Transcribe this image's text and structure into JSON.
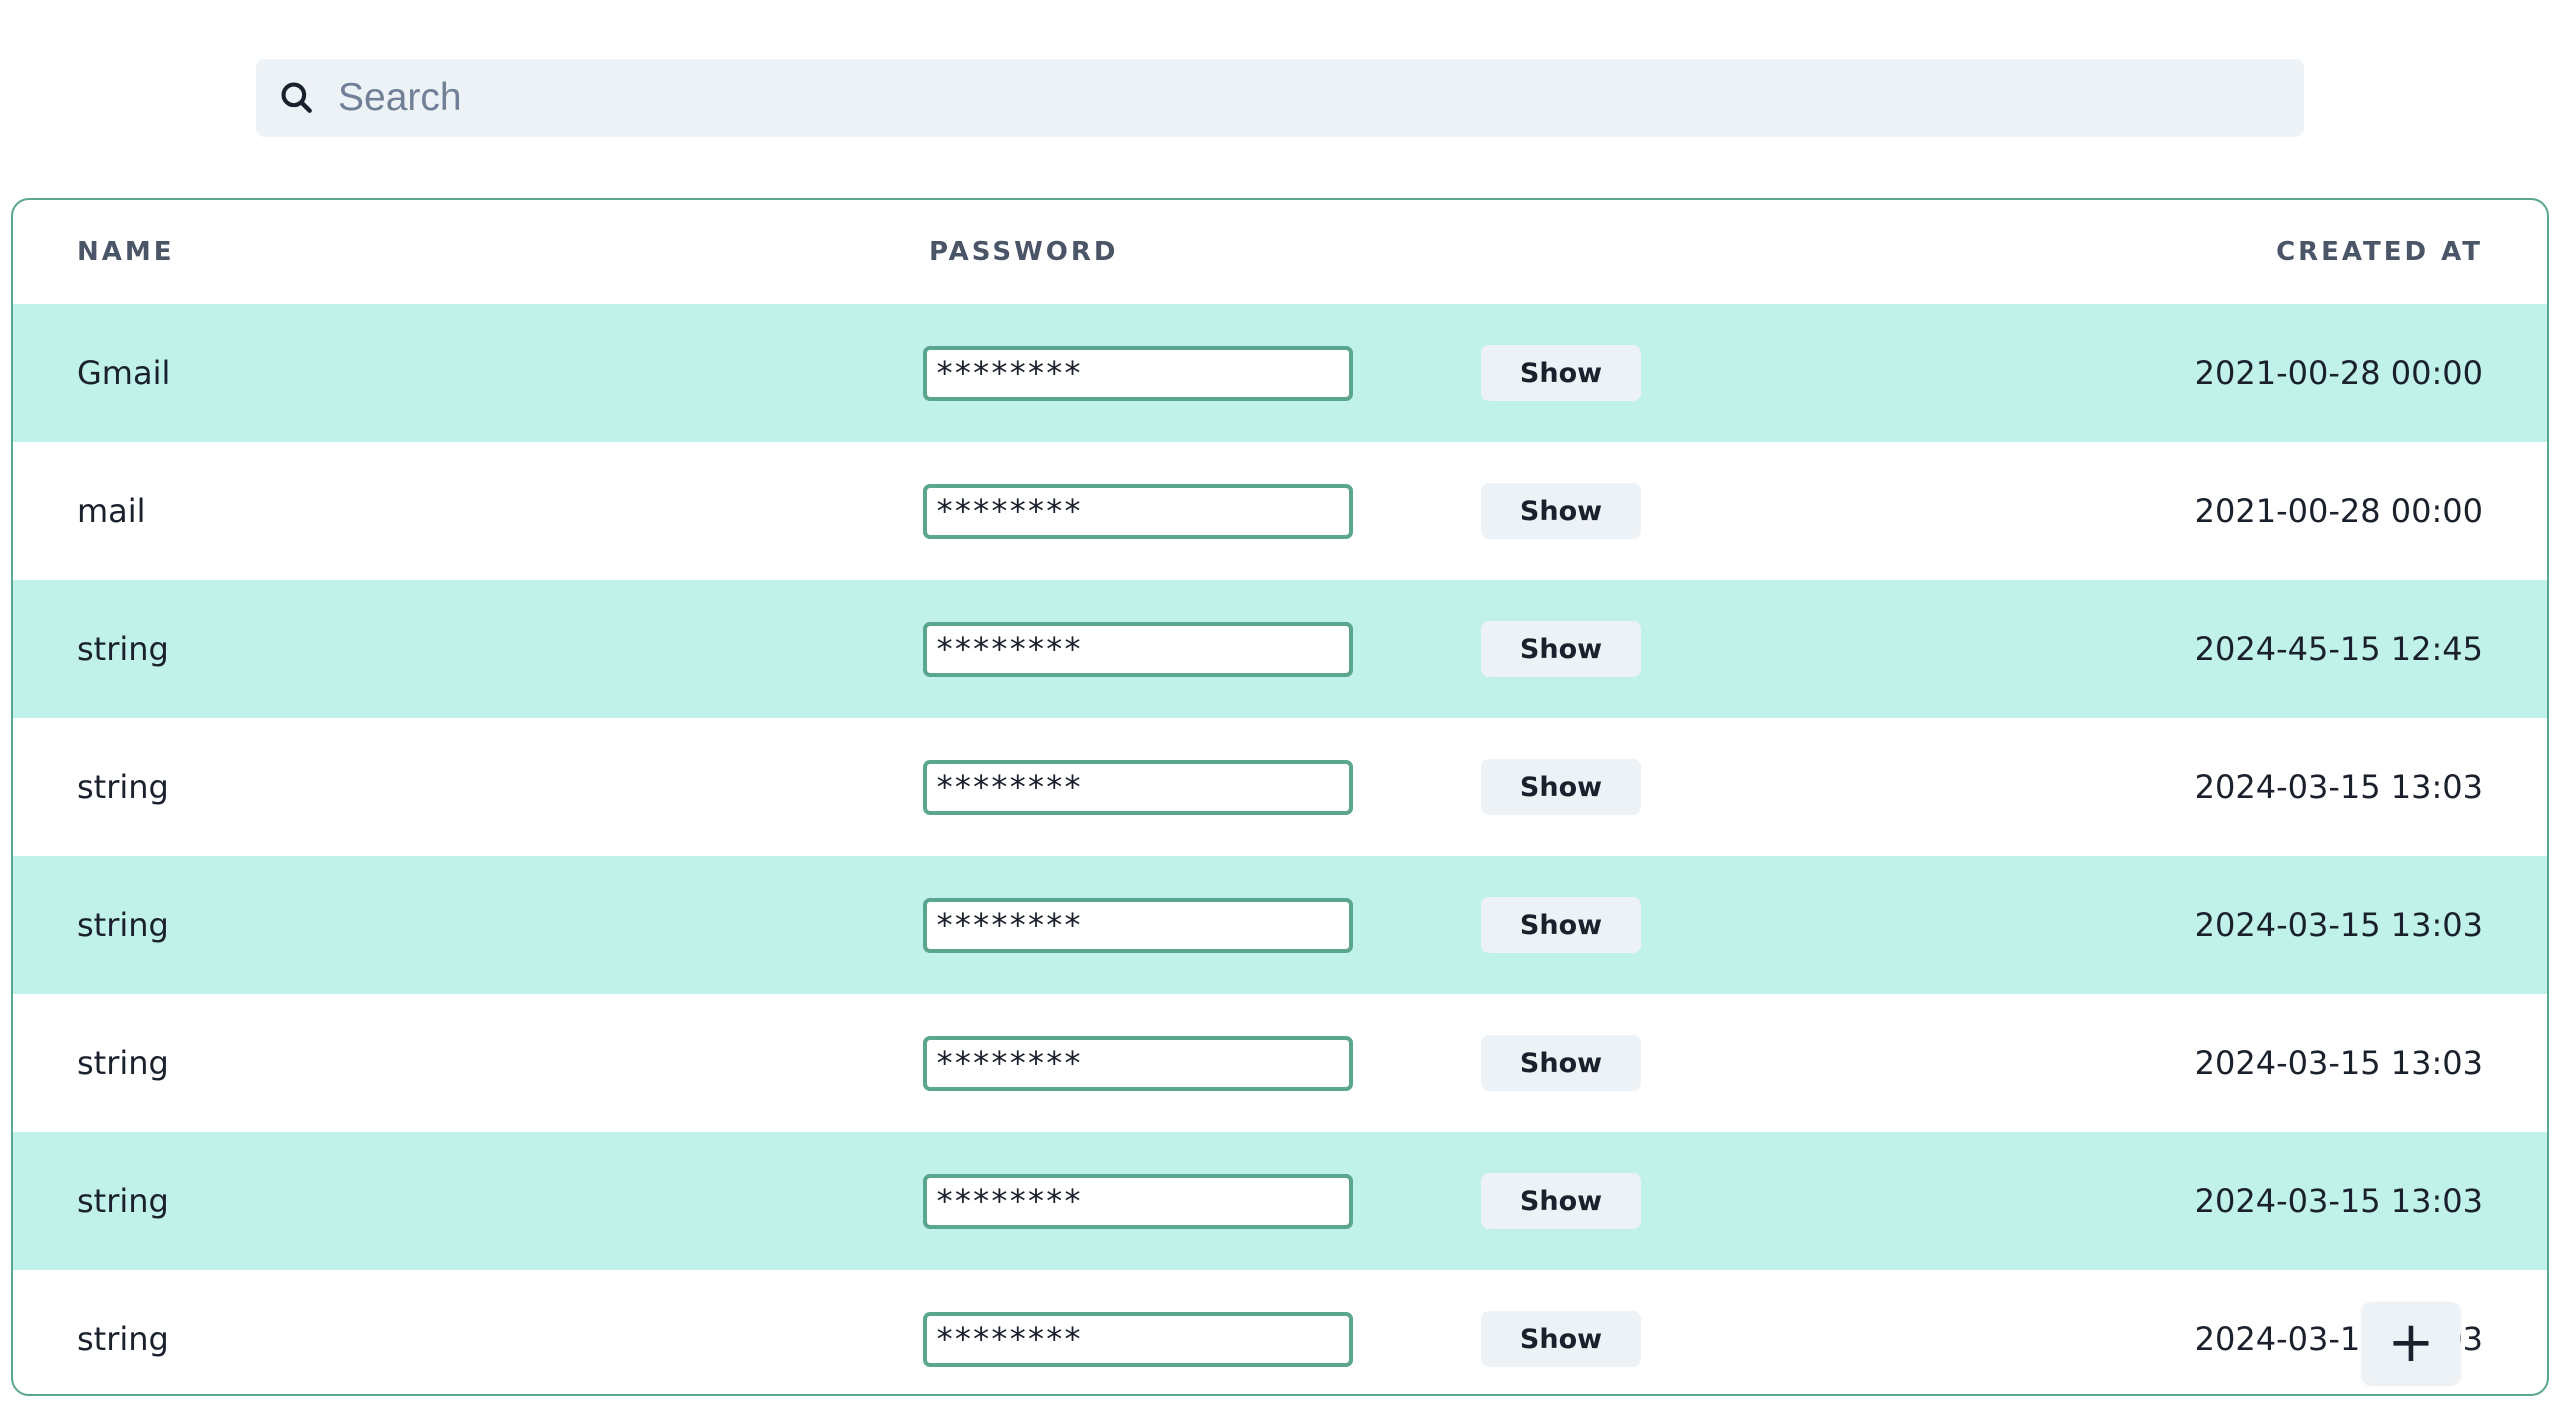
{
  "search": {
    "placeholder": "Search",
    "value": "",
    "icon": "search-icon"
  },
  "table": {
    "columns": {
      "name": "NAME",
      "password": "PASSWORD",
      "created_at": "CREATED AT"
    },
    "rows": [
      {
        "name": "Gmail",
        "password": "********",
        "show_label": "Show",
        "created_at": "2021-00-28 00:00"
      },
      {
        "name": "mail",
        "password": "********",
        "show_label": "Show",
        "created_at": "2021-00-28 00:00"
      },
      {
        "name": "string",
        "password": "********",
        "show_label": "Show",
        "created_at": "2024-45-15 12:45"
      },
      {
        "name": "string",
        "password": "********",
        "show_label": "Show",
        "created_at": "2024-03-15 13:03"
      },
      {
        "name": "string",
        "password": "********",
        "show_label": "Show",
        "created_at": "2024-03-15 13:03"
      },
      {
        "name": "string",
        "password": "********",
        "show_label": "Show",
        "created_at": "2024-03-15 13:03"
      },
      {
        "name": "string",
        "password": "********",
        "show_label": "Show",
        "created_at": "2024-03-15 13:03"
      },
      {
        "name": "string",
        "password": "********",
        "show_label": "Show",
        "created_at": "2024-03-15 13:03"
      }
    ]
  },
  "fab": {
    "icon": "plus-icon",
    "symbol": "+"
  },
  "colors": {
    "accent": "#5aa68e",
    "stripe": "#c0f2e9",
    "search_bg": "#edf2f7",
    "button_bg": "#edf2f7",
    "header_text": "#4a5568"
  }
}
